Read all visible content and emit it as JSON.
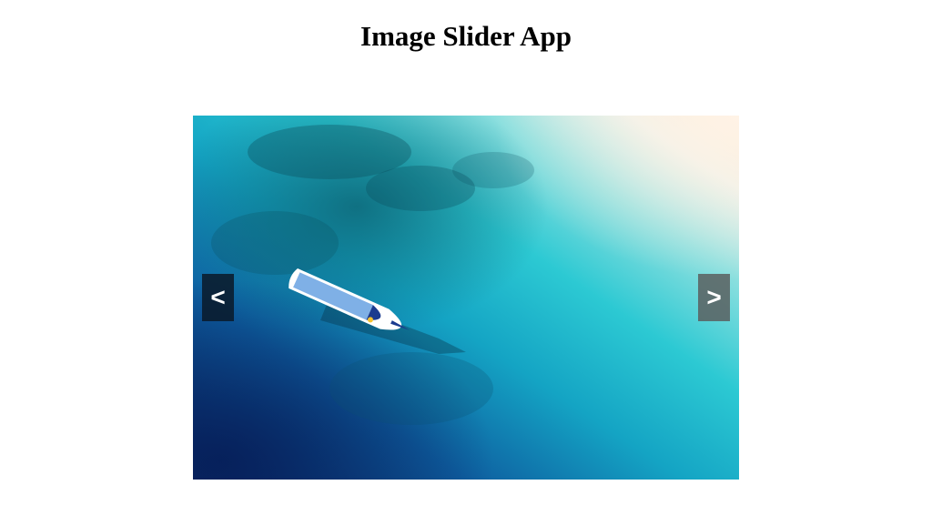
{
  "page": {
    "title": "Image Slider App"
  },
  "slider": {
    "prev_label": "<",
    "next_label": ">",
    "image_icon": "aerial-boat-ocean-photo"
  },
  "colors": {
    "deep_water": "#0b3d7a",
    "shallow_water": "#23c4cf",
    "sand": "#f5e7d6"
  }
}
